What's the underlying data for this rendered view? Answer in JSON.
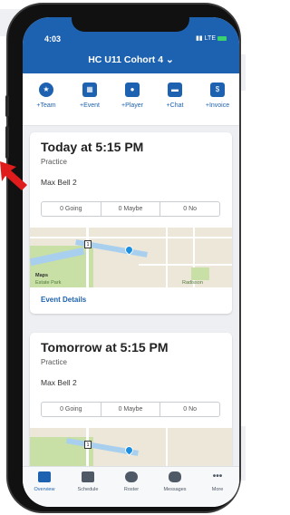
{
  "status": {
    "time": "4:03",
    "network": "LTE"
  },
  "header": {
    "title": "HC U11 Cohort 4",
    "chevron": "chevron-down-icon"
  },
  "actions": [
    {
      "label": "+Team",
      "icon": "team-icon"
    },
    {
      "label": "+Event",
      "icon": "calendar-icon"
    },
    {
      "label": "+Player",
      "icon": "person-icon"
    },
    {
      "label": "+Chat",
      "icon": "chat-icon"
    },
    {
      "label": "+Invoice",
      "icon": "moneybag-icon"
    }
  ],
  "events": [
    {
      "title": "Today at 5:15 PM",
      "type": "Practice",
      "location": "Max Bell 2",
      "rsvp": {
        "going": "0 Going",
        "maybe": "0 Maybe",
        "no": "0 No"
      },
      "map": {
        "attribution": "Maps",
        "labels": [
          "Estate Park",
          "Radisson"
        ],
        "route": "1"
      },
      "details_link": "Event Details"
    },
    {
      "title": "Tomorrow at 5:15 PM",
      "type": "Practice",
      "location": "Max Bell 2",
      "rsvp": {
        "going": "0 Going",
        "maybe": "0 Maybe",
        "no": "0 No"
      },
      "map": {
        "route": "1"
      }
    }
  ],
  "tabs": [
    {
      "label": "Overview",
      "active": true
    },
    {
      "label": "Schedule",
      "active": false
    },
    {
      "label": "Roster",
      "active": false
    },
    {
      "label": "Messages",
      "active": false
    },
    {
      "label": "More",
      "active": false
    }
  ],
  "colors": {
    "accent": "#1d62b0",
    "annotation_arrow": "#e01b1b"
  }
}
